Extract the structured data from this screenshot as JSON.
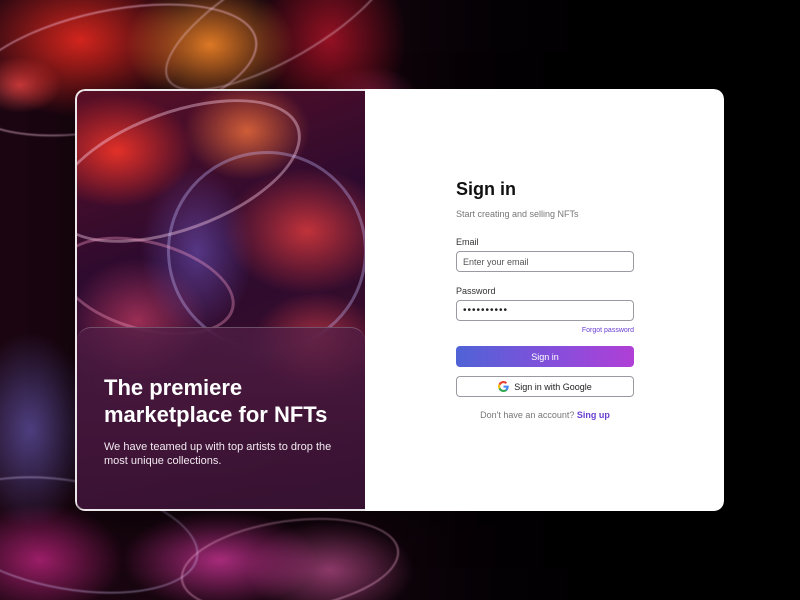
{
  "hero": {
    "headline": "The premiere marketplace for NFTs",
    "subline": "We have teamed up with top artists to drop the most unique collections."
  },
  "signin": {
    "title": "Sign in",
    "subtitle": "Start creating and selling NFTs",
    "email_label": "Email",
    "email_placeholder": "Enter your email",
    "password_label": "Password",
    "password_value": "••••••••••",
    "forgot_label": "Forgot password",
    "submit_label": "Sign in",
    "google_label": "Sign in with Google",
    "no_account_text": "Don't have an account?",
    "signup_label": "Sing up"
  },
  "colors": {
    "accent": "#6a3fd0",
    "button_gradient_start": "#4f63d6",
    "button_gradient_end": "#b03fd6"
  },
  "icons": {
    "google": "google-icon"
  }
}
